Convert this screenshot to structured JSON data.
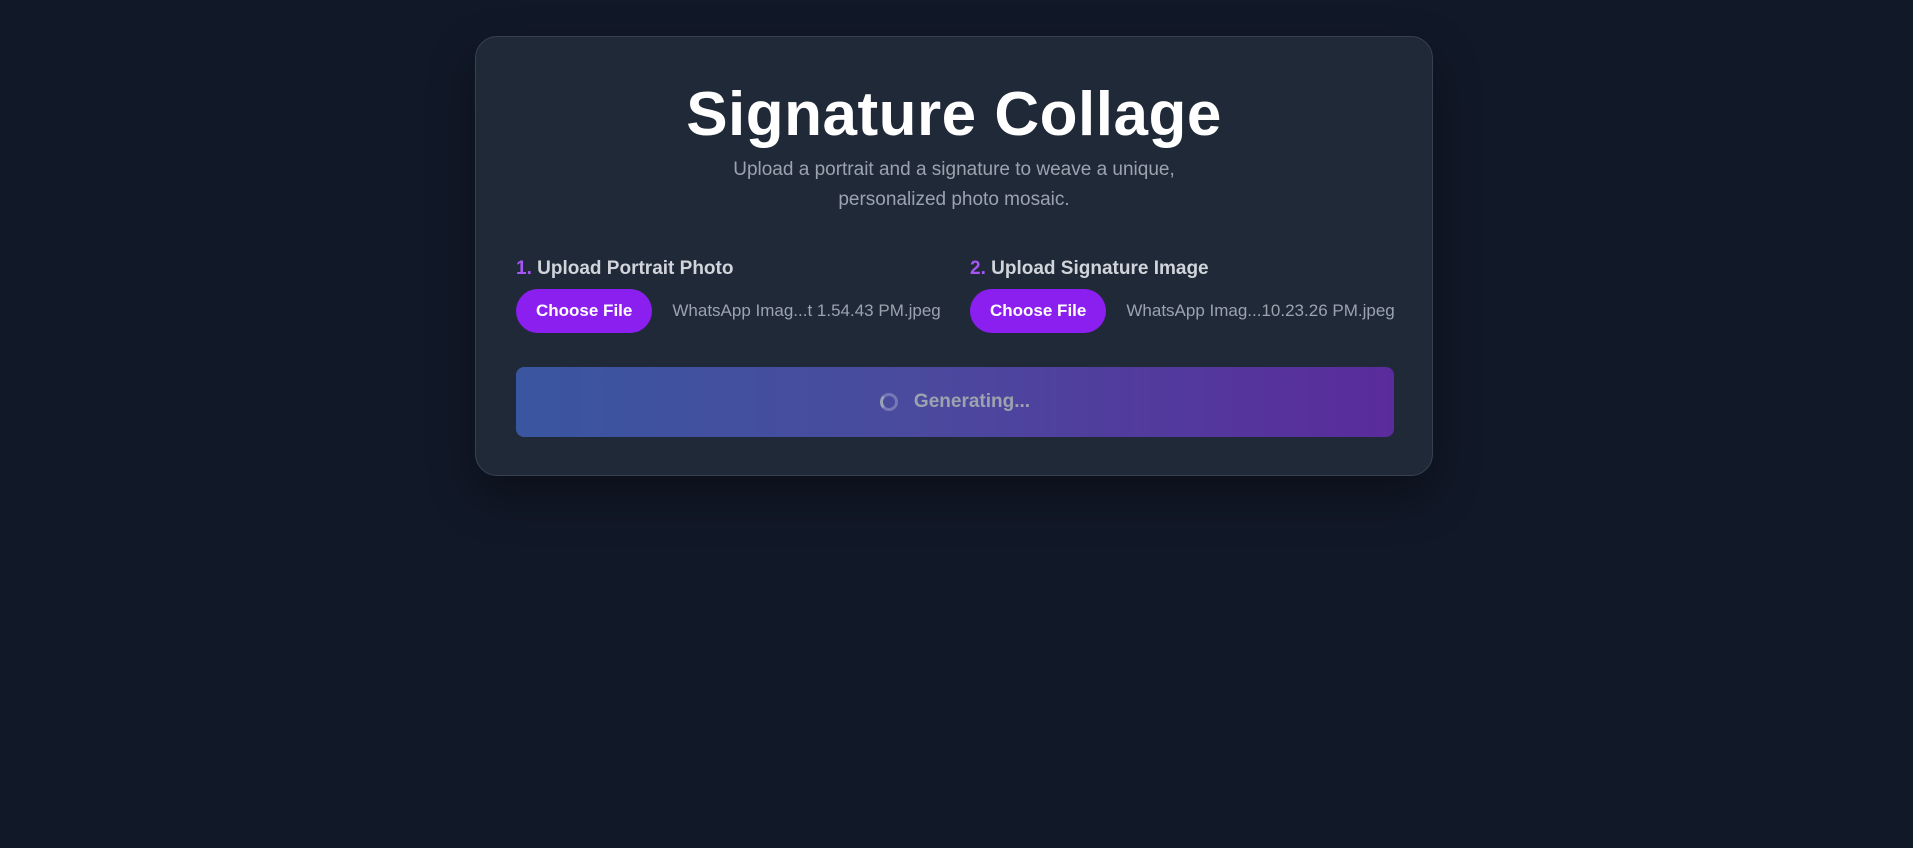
{
  "header": {
    "title": "Signature Collage",
    "subtitle_line1": "Upload a portrait and a signature to weave a unique,",
    "subtitle_line2": "personalized photo mosaic."
  },
  "uploads": [
    {
      "step": "1.",
      "label": "Upload Portrait Photo",
      "button_label": "Choose File",
      "file_name": "WhatsApp Imag...t 1.54.43 PM.jpeg"
    },
    {
      "step": "2.",
      "label": "Upload Signature Image",
      "button_label": "Choose File",
      "file_name": "WhatsApp Imag...10.23.26 PM.jpeg"
    }
  ],
  "generate": {
    "label": "Generating...",
    "spinner_icon": "loading-spinner-icon",
    "state": "loading"
  },
  "colors": {
    "background": "#111827",
    "card": "#1f2937",
    "accent": "#8b1ff0",
    "step_number": "#a855f7"
  }
}
